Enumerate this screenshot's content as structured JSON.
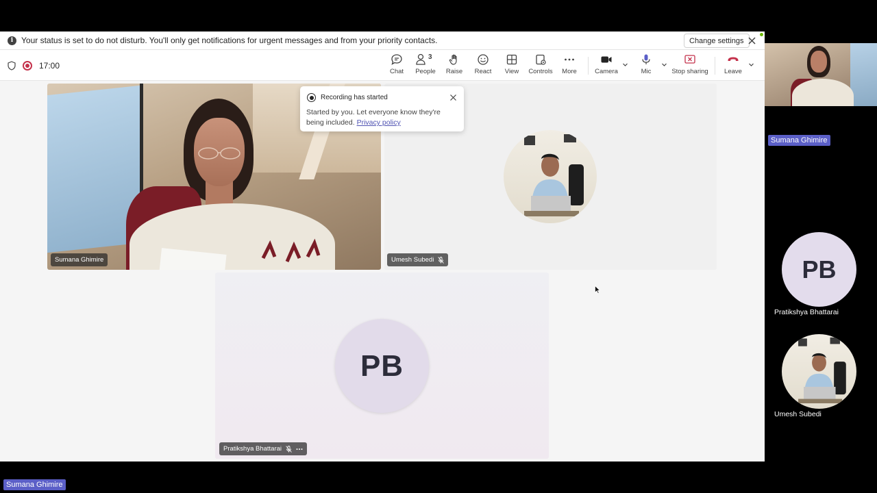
{
  "notification": {
    "text": "Your status is set to do not disturb. You'll only get notifications for urgent messages and from your priority contacts.",
    "change_label": "Change settings"
  },
  "meeting": {
    "timer": "17:00",
    "recording_color": "#c4314b"
  },
  "toolbar": {
    "chat": "Chat",
    "people": "People",
    "people_count": "3",
    "raise": "Raise",
    "react": "React",
    "view": "View",
    "controls": "Controls",
    "more": "More",
    "camera": "Camera",
    "mic": "Mic",
    "stop_sharing": "Stop sharing",
    "leave": "Leave",
    "leave_color": "#c4314b",
    "stop_sharing_color": "#c4314b"
  },
  "recording_popup": {
    "title": "Recording has started",
    "body": "Started by you. Let everyone know they're being included.",
    "link": "Privacy policy"
  },
  "tiles": {
    "video_name": "Sumana Ghimire",
    "umesh_name": "Umesh Subedi",
    "pb_name": "Pratikshya Bhattarai",
    "pb_initials": "PB"
  },
  "sidebar": {
    "self_tag": "Sumana Ghimire",
    "pb_initials": "PB",
    "pb_name": "Pratikshya Bhattarai",
    "umesh_name": "Umesh Subedi"
  },
  "bottom_tag": "Sumana Ghimire",
  "colors": {
    "tag_purple": "#5b5fc7",
    "link": "#4f52b2"
  }
}
